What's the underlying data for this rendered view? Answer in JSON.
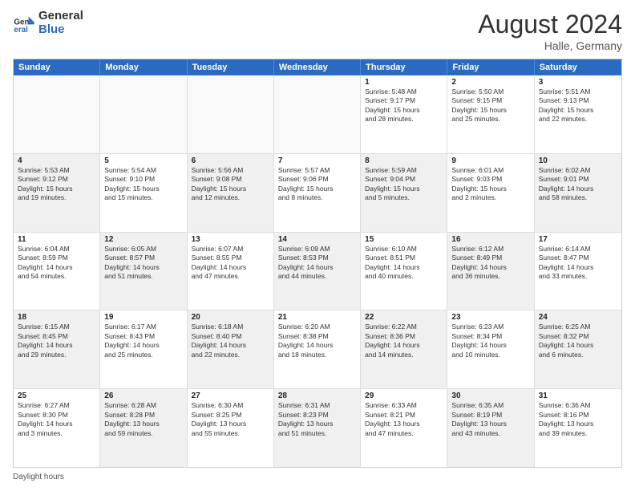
{
  "logo": {
    "general": "General",
    "blue": "Blue"
  },
  "title": {
    "month_year": "August 2024",
    "location": "Halle, Germany"
  },
  "calendar": {
    "headers": [
      "Sunday",
      "Monday",
      "Tuesday",
      "Wednesday",
      "Thursday",
      "Friday",
      "Saturday"
    ],
    "rows": [
      [
        {
          "day": "",
          "info": "",
          "empty": true
        },
        {
          "day": "",
          "info": "",
          "empty": true
        },
        {
          "day": "",
          "info": "",
          "empty": true
        },
        {
          "day": "",
          "info": "",
          "empty": true
        },
        {
          "day": "1",
          "info": "Sunrise: 5:48 AM\nSunset: 9:17 PM\nDaylight: 15 hours\nand 28 minutes."
        },
        {
          "day": "2",
          "info": "Sunrise: 5:50 AM\nSunset: 9:15 PM\nDaylight: 15 hours\nand 25 minutes."
        },
        {
          "day": "3",
          "info": "Sunrise: 5:51 AM\nSunset: 9:13 PM\nDaylight: 15 hours\nand 22 minutes."
        }
      ],
      [
        {
          "day": "4",
          "info": "Sunrise: 5:53 AM\nSunset: 9:12 PM\nDaylight: 15 hours\nand 19 minutes.",
          "shaded": true
        },
        {
          "day": "5",
          "info": "Sunrise: 5:54 AM\nSunset: 9:10 PM\nDaylight: 15 hours\nand 15 minutes."
        },
        {
          "day": "6",
          "info": "Sunrise: 5:56 AM\nSunset: 9:08 PM\nDaylight: 15 hours\nand 12 minutes.",
          "shaded": true
        },
        {
          "day": "7",
          "info": "Sunrise: 5:57 AM\nSunset: 9:06 PM\nDaylight: 15 hours\nand 8 minutes."
        },
        {
          "day": "8",
          "info": "Sunrise: 5:59 AM\nSunset: 9:04 PM\nDaylight: 15 hours\nand 5 minutes.",
          "shaded": true
        },
        {
          "day": "9",
          "info": "Sunrise: 6:01 AM\nSunset: 9:03 PM\nDaylight: 15 hours\nand 2 minutes."
        },
        {
          "day": "10",
          "info": "Sunrise: 6:02 AM\nSunset: 9:01 PM\nDaylight: 14 hours\nand 58 minutes.",
          "shaded": true
        }
      ],
      [
        {
          "day": "11",
          "info": "Sunrise: 6:04 AM\nSunset: 8:59 PM\nDaylight: 14 hours\nand 54 minutes."
        },
        {
          "day": "12",
          "info": "Sunrise: 6:05 AM\nSunset: 8:57 PM\nDaylight: 14 hours\nand 51 minutes.",
          "shaded": true
        },
        {
          "day": "13",
          "info": "Sunrise: 6:07 AM\nSunset: 8:55 PM\nDaylight: 14 hours\nand 47 minutes."
        },
        {
          "day": "14",
          "info": "Sunrise: 6:09 AM\nSunset: 8:53 PM\nDaylight: 14 hours\nand 44 minutes.",
          "shaded": true
        },
        {
          "day": "15",
          "info": "Sunrise: 6:10 AM\nSunset: 8:51 PM\nDaylight: 14 hours\nand 40 minutes."
        },
        {
          "day": "16",
          "info": "Sunrise: 6:12 AM\nSunset: 8:49 PM\nDaylight: 14 hours\nand 36 minutes.",
          "shaded": true
        },
        {
          "day": "17",
          "info": "Sunrise: 6:14 AM\nSunset: 8:47 PM\nDaylight: 14 hours\nand 33 minutes."
        }
      ],
      [
        {
          "day": "18",
          "info": "Sunrise: 6:15 AM\nSunset: 8:45 PM\nDaylight: 14 hours\nand 29 minutes.",
          "shaded": true
        },
        {
          "day": "19",
          "info": "Sunrise: 6:17 AM\nSunset: 8:43 PM\nDaylight: 14 hours\nand 25 minutes."
        },
        {
          "day": "20",
          "info": "Sunrise: 6:18 AM\nSunset: 8:40 PM\nDaylight: 14 hours\nand 22 minutes.",
          "shaded": true
        },
        {
          "day": "21",
          "info": "Sunrise: 6:20 AM\nSunset: 8:38 PM\nDaylight: 14 hours\nand 18 minutes."
        },
        {
          "day": "22",
          "info": "Sunrise: 6:22 AM\nSunset: 8:36 PM\nDaylight: 14 hours\nand 14 minutes.",
          "shaded": true
        },
        {
          "day": "23",
          "info": "Sunrise: 6:23 AM\nSunset: 8:34 PM\nDaylight: 14 hours\nand 10 minutes."
        },
        {
          "day": "24",
          "info": "Sunrise: 6:25 AM\nSunset: 8:32 PM\nDaylight: 14 hours\nand 6 minutes.",
          "shaded": true
        }
      ],
      [
        {
          "day": "25",
          "info": "Sunrise: 6:27 AM\nSunset: 8:30 PM\nDaylight: 14 hours\nand 3 minutes."
        },
        {
          "day": "26",
          "info": "Sunrise: 6:28 AM\nSunset: 8:28 PM\nDaylight: 13 hours\nand 59 minutes.",
          "shaded": true
        },
        {
          "day": "27",
          "info": "Sunrise: 6:30 AM\nSunset: 8:25 PM\nDaylight: 13 hours\nand 55 minutes."
        },
        {
          "day": "28",
          "info": "Sunrise: 6:31 AM\nSunset: 8:23 PM\nDaylight: 13 hours\nand 51 minutes.",
          "shaded": true
        },
        {
          "day": "29",
          "info": "Sunrise: 6:33 AM\nSunset: 8:21 PM\nDaylight: 13 hours\nand 47 minutes."
        },
        {
          "day": "30",
          "info": "Sunrise: 6:35 AM\nSunset: 8:19 PM\nDaylight: 13 hours\nand 43 minutes.",
          "shaded": true
        },
        {
          "day": "31",
          "info": "Sunrise: 6:36 AM\nSunset: 8:16 PM\nDaylight: 13 hours\nand 39 minutes."
        }
      ]
    ]
  },
  "footer": {
    "daylight_label": "Daylight hours"
  }
}
